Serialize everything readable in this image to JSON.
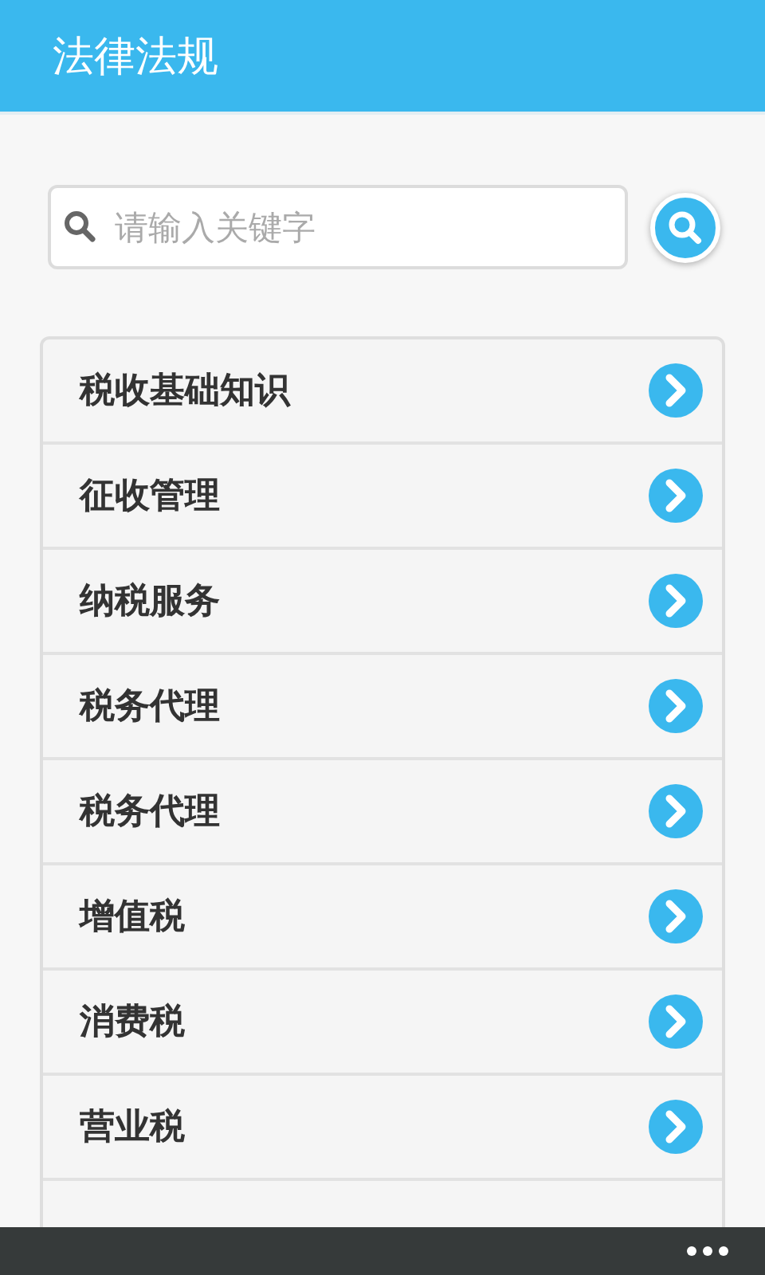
{
  "header": {
    "title": "法律法规"
  },
  "search": {
    "placeholder": "请输入关键字"
  },
  "categories": [
    {
      "label": "税收基础知识"
    },
    {
      "label": "征收管理"
    },
    {
      "label": "纳税服务"
    },
    {
      "label": "税务代理"
    },
    {
      "label": "税务代理"
    },
    {
      "label": "增值税"
    },
    {
      "label": "消费税"
    },
    {
      "label": "营业税"
    }
  ]
}
